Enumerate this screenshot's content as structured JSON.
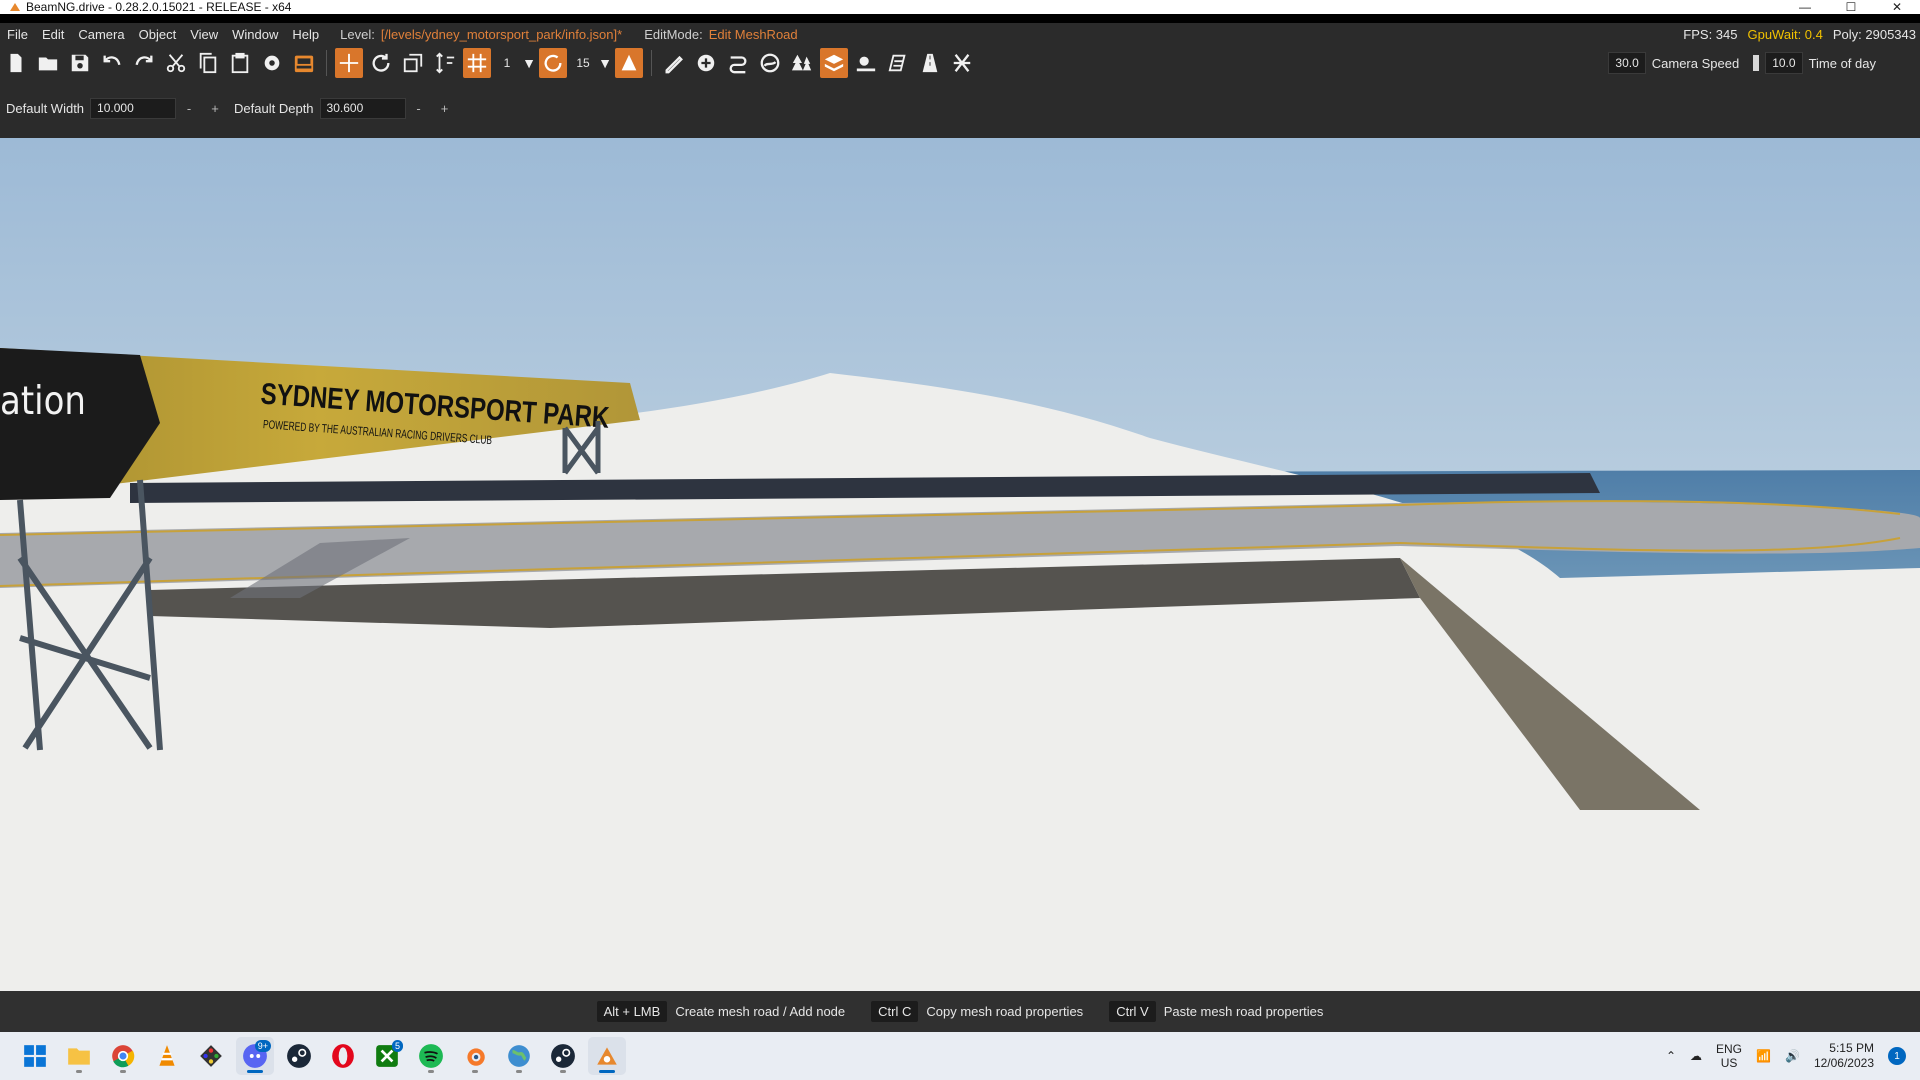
{
  "window": {
    "title": "BeamNG.drive - 0.28.2.0.15021 - RELEASE - x64",
    "controls": [
      "—",
      "☐",
      "✕"
    ]
  },
  "menu": {
    "items": [
      "File",
      "Edit",
      "Camera",
      "Object",
      "View",
      "Window",
      "Help"
    ],
    "level_label": "Level:",
    "level_value": "[/levels/ydney_motorsport_park/info.json]*",
    "editmode_label": "EditMode:",
    "editmode_value": "Edit MeshRoad"
  },
  "stats": {
    "fps": "FPS: 345",
    "gpuwait": "GpuWait: 0.4",
    "poly": "Poly: 2905343"
  },
  "toolbar": {
    "snap_value": "1",
    "rotate_snap_value": "15",
    "camera_value": "30.0",
    "camera_speed_label": "Camera Speed",
    "time_value": "10.0",
    "time_label": "Time of day"
  },
  "properties": {
    "width_label": "Default Width",
    "width_value": "10.000",
    "depth_label": "Default Depth",
    "depth_value": "30.600",
    "minus": "-",
    "plus": "+"
  },
  "scene": {
    "sign_text_partial": "ation",
    "sign_title": "SYDNEY MOTORSPORT PARK",
    "sign_subtitle": "POWERED BY THE AUSTRALIAN RACING DRIVERS CLUB"
  },
  "hints": [
    {
      "key": "Alt + LMB",
      "text": "Create mesh road / Add node"
    },
    {
      "key": "Ctrl C",
      "text": "Copy mesh road properties"
    },
    {
      "key": "Ctrl V",
      "text": "Paste mesh road properties"
    }
  ],
  "taskbar": {
    "badges": {
      "discord": "9+",
      "xbox": "5"
    },
    "lang_top": "ENG",
    "lang_bottom": "US",
    "time": "5:15 PM",
    "date": "12/06/2023",
    "notification_count": "1"
  },
  "colors": {
    "accent_orange": "#e0803a",
    "gpu_yellow": "#f2c200",
    "panel_bg": "#2b2b2b",
    "taskbar_bg": "#e9edf3"
  }
}
